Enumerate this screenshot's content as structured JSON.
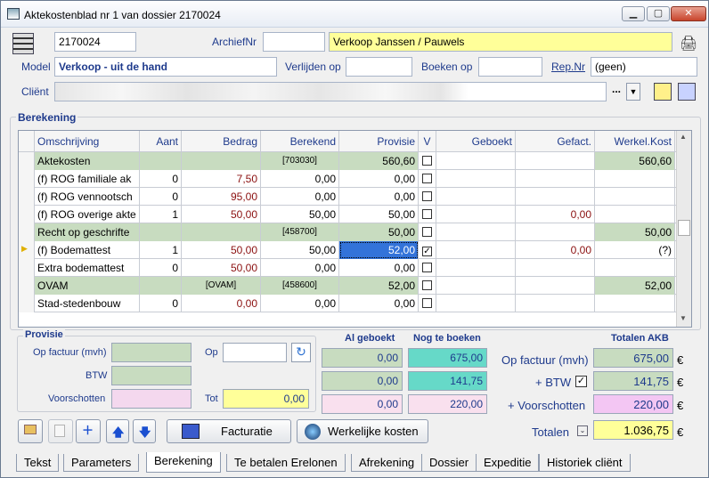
{
  "window": {
    "title": "Aktekostenblad nr 1 van dossier 2170024",
    "minimize": "▁",
    "maximize": "▢",
    "close": "✕"
  },
  "top": {
    "dossier_nr": "2170024",
    "archief_label": "ArchiefNr",
    "archief_value": "",
    "name_value": "Verkoop Janssen / Pauwels",
    "model_label": "Model",
    "model_value": "Verkoop - uit de hand",
    "verlijden_label": "Verlijden op",
    "verlijden_value": "",
    "boeken_label": "Boeken op",
    "boeken_value": "",
    "rep_label": "Rep.Nr",
    "rep_value": "(geen)",
    "client_label": "Cliënt",
    "client_value": "",
    "client_dots": "..."
  },
  "berekening": {
    "title": "Berekening",
    "headers": {
      "omschrijving": "Omschrijving",
      "aant": "Aant",
      "bedrag": "Bedrag",
      "berekend": "Berekend",
      "provisie": "Provisie",
      "v": "V",
      "geboekt": "Geboekt",
      "gefact": "Gefact.",
      "werkel": "Werkel.Kost"
    },
    "rows": [
      {
        "omschrijving": "Aktekosten",
        "aant": "",
        "bedrag": "",
        "berekend": "[703030]",
        "provisie": "560,60",
        "v": "",
        "geboekt": "",
        "gefact": "",
        "werkel": "560,60"
      },
      {
        "omschrijving": "(f) ROG familiale ak",
        "aant": "0",
        "bedrag": "7,50",
        "berekend": "0,00",
        "provisie": "0,00",
        "v": "",
        "geboekt": "",
        "gefact": "",
        "werkel": ""
      },
      {
        "omschrijving": "(f) ROG vennootsch",
        "aant": "0",
        "bedrag": "95,00",
        "berekend": "0,00",
        "provisie": "0,00",
        "v": "",
        "geboekt": "",
        "gefact": "",
        "werkel": ""
      },
      {
        "omschrijving": "(f) ROG overige akte",
        "aant": "1",
        "bedrag": "50,00",
        "berekend": "50,00",
        "provisie": "50,00",
        "v": "",
        "geboekt": "",
        "gefact": "0,00",
        "werkel": ""
      },
      {
        "omschrijving": "Recht op geschrifte",
        "aant": "",
        "bedrag": "",
        "berekend": "[458700]",
        "provisie": "50,00",
        "v": "",
        "geboekt": "",
        "gefact": "",
        "werkel": "50,00"
      },
      {
        "omschrijving": "(f) Bodemattest",
        "aant": "1",
        "bedrag": "50,00",
        "berekend": "50,00",
        "provisie": "52,00",
        "v": "✓",
        "geboekt": "",
        "gefact": "0,00",
        "werkel": "(?)"
      },
      {
        "omschrijving": "Extra bodemattest",
        "aant": "0",
        "bedrag": "50,00",
        "berekend": "0,00",
        "provisie": "0,00",
        "v": "",
        "geboekt": "",
        "gefact": "",
        "werkel": ""
      },
      {
        "omschrijving": "OVAM",
        "aant": "",
        "bedrag": "[OVAM]",
        "berekend": "[458600]",
        "provisie": "52,00",
        "v": "",
        "geboekt": "",
        "gefact": "",
        "werkel": "52,00"
      },
      {
        "omschrijving": "Stad-stedenbouw",
        "aant": "0",
        "bedrag": "0,00",
        "berekend": "0,00",
        "provisie": "0,00",
        "v": "",
        "geboekt": "",
        "gefact": "",
        "werkel": ""
      }
    ]
  },
  "provisie": {
    "title": "Provisie",
    "op_factuur_label": "Op factuur (mvh)",
    "btw_label": "BTW",
    "voorschotten_label": "Voorschotten",
    "op_label": "Op",
    "tot_label": "Tot",
    "tot_value": "0,00"
  },
  "summary": {
    "al_geboekt": "Al geboekt",
    "nog_te_boeken": "Nog te boeken",
    "totalen_akb": "Totalen AKB",
    "geboekt_vals": [
      "0,00",
      "0,00",
      "0,00"
    ],
    "nog_vals": [
      "675,00",
      "141,75",
      "220,00"
    ],
    "row_labels": [
      "Op factuur (mvh)",
      "+ BTW",
      "+ Voorschotten"
    ],
    "totals": [
      "675,00",
      "141,75",
      "220,00"
    ],
    "totalen_label": "Totalen",
    "totalen_value": "1.036,75",
    "euro": "€"
  },
  "buttons": {
    "facturatie": "Facturatie",
    "werkelijke_kosten": "Werkelijke kosten"
  },
  "tabs": [
    "Tekst",
    "Parameters",
    "Berekening",
    "Te betalen Erelonen",
    "Afrekening",
    "Dossier",
    "Expeditie",
    "Historiek cliënt"
  ],
  "colors": {
    "green": "#c8dcc0",
    "teal": "#66d9c8",
    "pink": "#f4d8ee",
    "yellow": "#ffff99",
    "violet": "#f3c6f3"
  }
}
